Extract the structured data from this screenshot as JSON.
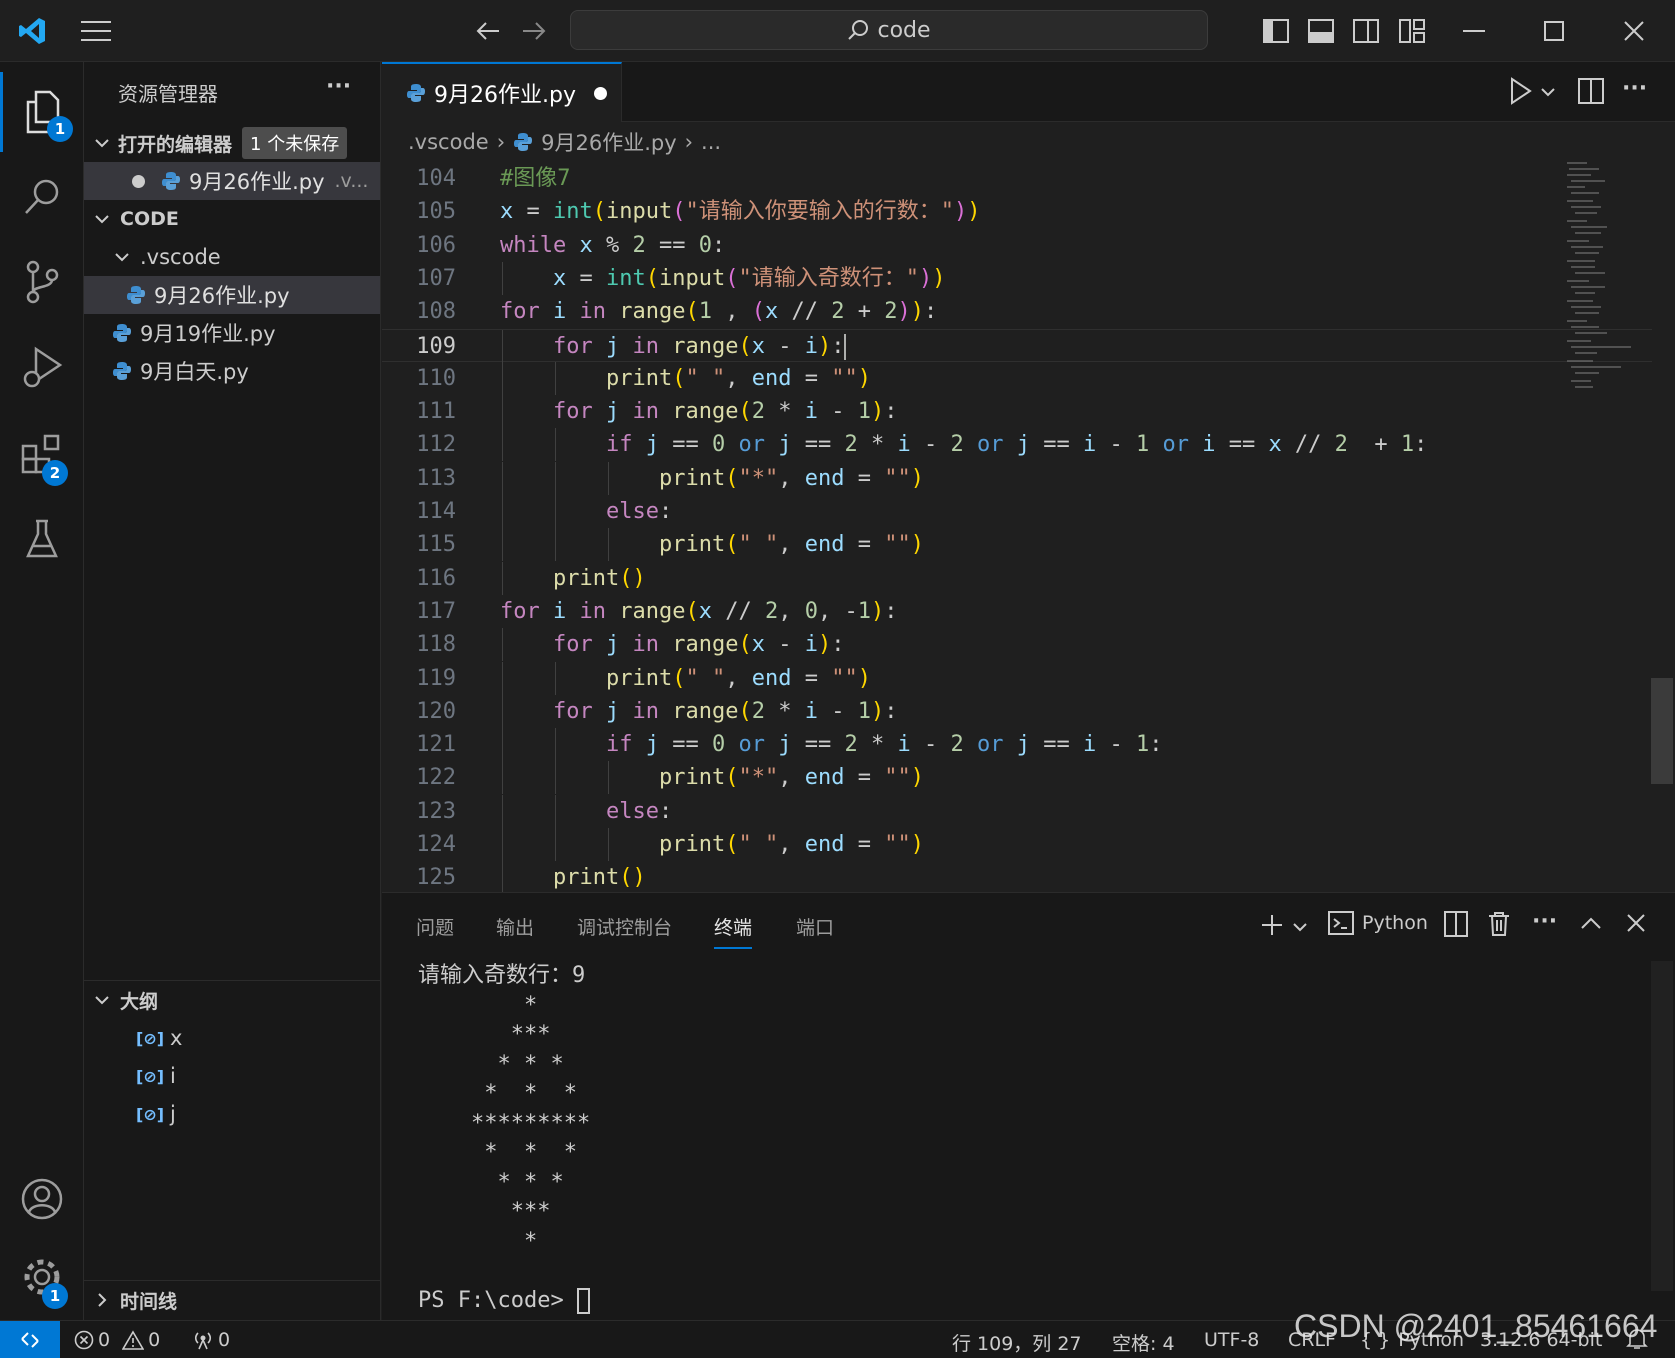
{
  "titlebar": {
    "search_text": "code"
  },
  "activitybar": {
    "explorer_badge": "1",
    "extensions_badge": "2",
    "settings_badge": "1"
  },
  "sidebar": {
    "title": "资源管理器",
    "more": "···",
    "open_editors": {
      "title": "打开的编辑器",
      "badge": "1 个未保存",
      "items": [
        {
          "name": "9月26作业.py",
          "path": ".v..."
        }
      ]
    },
    "workspace": {
      "title": "CODE",
      "folder": ".vscode",
      "files": [
        "9月26作业.py",
        "9月19作业.py",
        "9月白天.py"
      ]
    },
    "outline": {
      "title": "大纲",
      "items": [
        "x",
        "i",
        "j"
      ]
    },
    "timeline": {
      "title": "时间线"
    }
  },
  "editor": {
    "tab_label": "9月26作业.py",
    "breadcrumb": {
      "folder": ".vscode",
      "file": "9月26作业.py",
      "tail": "..."
    },
    "active_line": 109
  },
  "code_lines": [
    {
      "n": "104",
      "i": 0,
      "t": [
        [
          "c",
          "#图像7"
        ]
      ]
    },
    {
      "n": "105",
      "i": 0,
      "t": [
        [
          "v",
          "x"
        ],
        [
          "o",
          " = "
        ],
        [
          "b",
          "int"
        ],
        [
          "p1",
          "("
        ],
        [
          "f",
          "input"
        ],
        [
          "p2",
          "("
        ],
        [
          "s",
          "\"请输入你要输入的行数：\""
        ],
        [
          "p2",
          ")"
        ],
        [
          "p1",
          ")"
        ]
      ]
    },
    {
      "n": "106",
      "i": 0,
      "t": [
        [
          "kc",
          "while"
        ],
        [
          "o",
          " "
        ],
        [
          "v",
          "x"
        ],
        [
          "o",
          " % "
        ],
        [
          "n",
          "2"
        ],
        [
          "o",
          " == "
        ],
        [
          "n",
          "0"
        ],
        [
          "o",
          ":"
        ]
      ]
    },
    {
      "n": "107",
      "i": 1,
      "t": [
        [
          "v",
          "x"
        ],
        [
          "o",
          " = "
        ],
        [
          "b",
          "int"
        ],
        [
          "p1",
          "("
        ],
        [
          "f",
          "input"
        ],
        [
          "p2",
          "("
        ],
        [
          "s",
          "\"请输入奇数行：\""
        ],
        [
          "p2",
          ")"
        ],
        [
          "p1",
          ")"
        ]
      ]
    },
    {
      "n": "108",
      "i": 0,
      "t": [
        [
          "kc",
          "for"
        ],
        [
          "o",
          " "
        ],
        [
          "v",
          "i"
        ],
        [
          "o",
          " "
        ],
        [
          "kc",
          "in"
        ],
        [
          "o",
          " "
        ],
        [
          "f",
          "range"
        ],
        [
          "p1",
          "("
        ],
        [
          "n",
          "1"
        ],
        [
          "o",
          " , "
        ],
        [
          "p2",
          "("
        ],
        [
          "v",
          "x"
        ],
        [
          "o",
          " // "
        ],
        [
          "n",
          "2"
        ],
        [
          "o",
          " + "
        ],
        [
          "n",
          "2"
        ],
        [
          "p2",
          ")"
        ],
        [
          "p1",
          ")"
        ],
        [
          "o",
          ":"
        ]
      ]
    },
    {
      "n": "109",
      "i": 1,
      "t": [
        [
          "kc",
          "for"
        ],
        [
          "o",
          " "
        ],
        [
          "v",
          "j"
        ],
        [
          "o",
          " "
        ],
        [
          "kc",
          "in"
        ],
        [
          "o",
          " "
        ],
        [
          "f",
          "range"
        ],
        [
          "p1",
          "("
        ],
        [
          "v",
          "x"
        ],
        [
          "o",
          " - "
        ],
        [
          "v",
          "i"
        ],
        [
          "p1",
          ")"
        ],
        [
          "o",
          ":"
        ]
      ]
    },
    {
      "n": "110",
      "i": 2,
      "t": [
        [
          "f",
          "print"
        ],
        [
          "p1",
          "("
        ],
        [
          "s",
          "\" \""
        ],
        [
          "o",
          ", "
        ],
        [
          "v",
          "end"
        ],
        [
          "o",
          " = "
        ],
        [
          "s",
          "\"\""
        ],
        [
          "p1",
          ")"
        ]
      ]
    },
    {
      "n": "111",
      "i": 1,
      "t": [
        [
          "kc",
          "for"
        ],
        [
          "o",
          " "
        ],
        [
          "v",
          "j"
        ],
        [
          "o",
          " "
        ],
        [
          "kc",
          "in"
        ],
        [
          "o",
          " "
        ],
        [
          "f",
          "range"
        ],
        [
          "p1",
          "("
        ],
        [
          "n",
          "2"
        ],
        [
          "o",
          " * "
        ],
        [
          "v",
          "i"
        ],
        [
          "o",
          " - "
        ],
        [
          "n",
          "1"
        ],
        [
          "p1",
          ")"
        ],
        [
          "o",
          ":"
        ]
      ]
    },
    {
      "n": "112",
      "i": 2,
      "t": [
        [
          "kc",
          "if"
        ],
        [
          "o",
          " "
        ],
        [
          "v",
          "j"
        ],
        [
          "o",
          " == "
        ],
        [
          "n",
          "0"
        ],
        [
          "o",
          " "
        ],
        [
          "k",
          "or"
        ],
        [
          "o",
          " "
        ],
        [
          "v",
          "j"
        ],
        [
          "o",
          " == "
        ],
        [
          "n",
          "2"
        ],
        [
          "o",
          " * "
        ],
        [
          "v",
          "i"
        ],
        [
          "o",
          " - "
        ],
        [
          "n",
          "2"
        ],
        [
          "o",
          " "
        ],
        [
          "k",
          "or"
        ],
        [
          "o",
          " "
        ],
        [
          "v",
          "j"
        ],
        [
          "o",
          " == "
        ],
        [
          "v",
          "i"
        ],
        [
          "o",
          " - "
        ],
        [
          "n",
          "1"
        ],
        [
          "o",
          " "
        ],
        [
          "k",
          "or"
        ],
        [
          "o",
          " "
        ],
        [
          "v",
          "i"
        ],
        [
          "o",
          " == "
        ],
        [
          "v",
          "x"
        ],
        [
          "o",
          " // "
        ],
        [
          "n",
          "2"
        ],
        [
          "o",
          "  + "
        ],
        [
          "n",
          "1"
        ],
        [
          "o",
          ":"
        ]
      ]
    },
    {
      "n": "113",
      "i": 3,
      "t": [
        [
          "f",
          "print"
        ],
        [
          "p1",
          "("
        ],
        [
          "s",
          "\"*\""
        ],
        [
          "o",
          ", "
        ],
        [
          "v",
          "end"
        ],
        [
          "o",
          " = "
        ],
        [
          "s",
          "\"\""
        ],
        [
          "p1",
          ")"
        ]
      ]
    },
    {
      "n": "114",
      "i": 2,
      "t": [
        [
          "kc",
          "else"
        ],
        [
          "o",
          ":"
        ]
      ]
    },
    {
      "n": "115",
      "i": 3,
      "t": [
        [
          "f",
          "print"
        ],
        [
          "p1",
          "("
        ],
        [
          "s",
          "\" \""
        ],
        [
          "o",
          ", "
        ],
        [
          "v",
          "end"
        ],
        [
          "o",
          " = "
        ],
        [
          "s",
          "\"\""
        ],
        [
          "p1",
          ")"
        ]
      ]
    },
    {
      "n": "116",
      "i": 1,
      "t": [
        [
          "f",
          "print"
        ],
        [
          "p1",
          "()"
        ]
      ]
    },
    {
      "n": "117",
      "i": 0,
      "t": [
        [
          "kc",
          "for"
        ],
        [
          "o",
          " "
        ],
        [
          "v",
          "i"
        ],
        [
          "o",
          " "
        ],
        [
          "kc",
          "in"
        ],
        [
          "o",
          " "
        ],
        [
          "f",
          "range"
        ],
        [
          "p1",
          "("
        ],
        [
          "v",
          "x"
        ],
        [
          "o",
          " // "
        ],
        [
          "n",
          "2"
        ],
        [
          "o",
          ", "
        ],
        [
          "n",
          "0"
        ],
        [
          "o",
          ", -"
        ],
        [
          "n",
          "1"
        ],
        [
          "p1",
          ")"
        ],
        [
          "o",
          ":"
        ]
      ]
    },
    {
      "n": "118",
      "i": 1,
      "t": [
        [
          "kc",
          "for"
        ],
        [
          "o",
          " "
        ],
        [
          "v",
          "j"
        ],
        [
          "o",
          " "
        ],
        [
          "kc",
          "in"
        ],
        [
          "o",
          " "
        ],
        [
          "f",
          "range"
        ],
        [
          "p1",
          "("
        ],
        [
          "v",
          "x"
        ],
        [
          "o",
          " - "
        ],
        [
          "v",
          "i"
        ],
        [
          "p1",
          ")"
        ],
        [
          "o",
          ":"
        ]
      ]
    },
    {
      "n": "119",
      "i": 2,
      "t": [
        [
          "f",
          "print"
        ],
        [
          "p1",
          "("
        ],
        [
          "s",
          "\" \""
        ],
        [
          "o",
          ", "
        ],
        [
          "v",
          "end"
        ],
        [
          "o",
          " = "
        ],
        [
          "s",
          "\"\""
        ],
        [
          "p1",
          ")"
        ]
      ]
    },
    {
      "n": "120",
      "i": 1,
      "t": [
        [
          "kc",
          "for"
        ],
        [
          "o",
          " "
        ],
        [
          "v",
          "j"
        ],
        [
          "o",
          " "
        ],
        [
          "kc",
          "in"
        ],
        [
          "o",
          " "
        ],
        [
          "f",
          "range"
        ],
        [
          "p1",
          "("
        ],
        [
          "n",
          "2"
        ],
        [
          "o",
          " * "
        ],
        [
          "v",
          "i"
        ],
        [
          "o",
          " - "
        ],
        [
          "n",
          "1"
        ],
        [
          "p1",
          ")"
        ],
        [
          "o",
          ":"
        ]
      ]
    },
    {
      "n": "121",
      "i": 2,
      "t": [
        [
          "kc",
          "if"
        ],
        [
          "o",
          " "
        ],
        [
          "v",
          "j"
        ],
        [
          "o",
          " == "
        ],
        [
          "n",
          "0"
        ],
        [
          "o",
          " "
        ],
        [
          "k",
          "or"
        ],
        [
          "o",
          " "
        ],
        [
          "v",
          "j"
        ],
        [
          "o",
          " == "
        ],
        [
          "n",
          "2"
        ],
        [
          "o",
          " * "
        ],
        [
          "v",
          "i"
        ],
        [
          "o",
          " - "
        ],
        [
          "n",
          "2"
        ],
        [
          "o",
          " "
        ],
        [
          "k",
          "or"
        ],
        [
          "o",
          " "
        ],
        [
          "v",
          "j"
        ],
        [
          "o",
          " == "
        ],
        [
          "v",
          "i"
        ],
        [
          "o",
          " - "
        ],
        [
          "n",
          "1"
        ],
        [
          "o",
          ":"
        ]
      ]
    },
    {
      "n": "122",
      "i": 3,
      "t": [
        [
          "f",
          "print"
        ],
        [
          "p1",
          "("
        ],
        [
          "s",
          "\"*\""
        ],
        [
          "o",
          ", "
        ],
        [
          "v",
          "end"
        ],
        [
          "o",
          " = "
        ],
        [
          "s",
          "\"\""
        ],
        [
          "p1",
          ")"
        ]
      ]
    },
    {
      "n": "123",
      "i": 2,
      "t": [
        [
          "kc",
          "else"
        ],
        [
          "o",
          ":"
        ]
      ]
    },
    {
      "n": "124",
      "i": 3,
      "t": [
        [
          "f",
          "print"
        ],
        [
          "p1",
          "("
        ],
        [
          "s",
          "\" \""
        ],
        [
          "o",
          ", "
        ],
        [
          "v",
          "end"
        ],
        [
          "o",
          " = "
        ],
        [
          "s",
          "\"\""
        ],
        [
          "p1",
          ")"
        ]
      ]
    },
    {
      "n": "125",
      "i": 1,
      "t": [
        [
          "f",
          "print"
        ],
        [
          "p1",
          "()"
        ]
      ]
    }
  ],
  "panel": {
    "tabs": [
      "问题",
      "输出",
      "调试控制台",
      "终端",
      "端口"
    ],
    "active_tab": "终端",
    "terminal_name": "Python",
    "terminal_lines": [
      "请输入奇数行：9",
      "        *",
      "       ***",
      "      * * *",
      "     *  *  *",
      "    *********",
      "     *  *  *",
      "      * * *",
      "       ***",
      "        *",
      "",
      "PS F:\\code> "
    ]
  },
  "statusbar": {
    "errors": "0",
    "warnings": "0",
    "ports": "0",
    "position": "行 109，列 27",
    "spaces": "空格: 4",
    "encoding": "UTF-8",
    "eol": "CRLF",
    "language": "Python",
    "interpreter": "3.12.6 64-bit"
  },
  "watermark": "CSDN @2401_85461664",
  "colors": {
    "accent": "#0078d4",
    "background": "#1f1f1f",
    "sidebar": "#181818"
  }
}
